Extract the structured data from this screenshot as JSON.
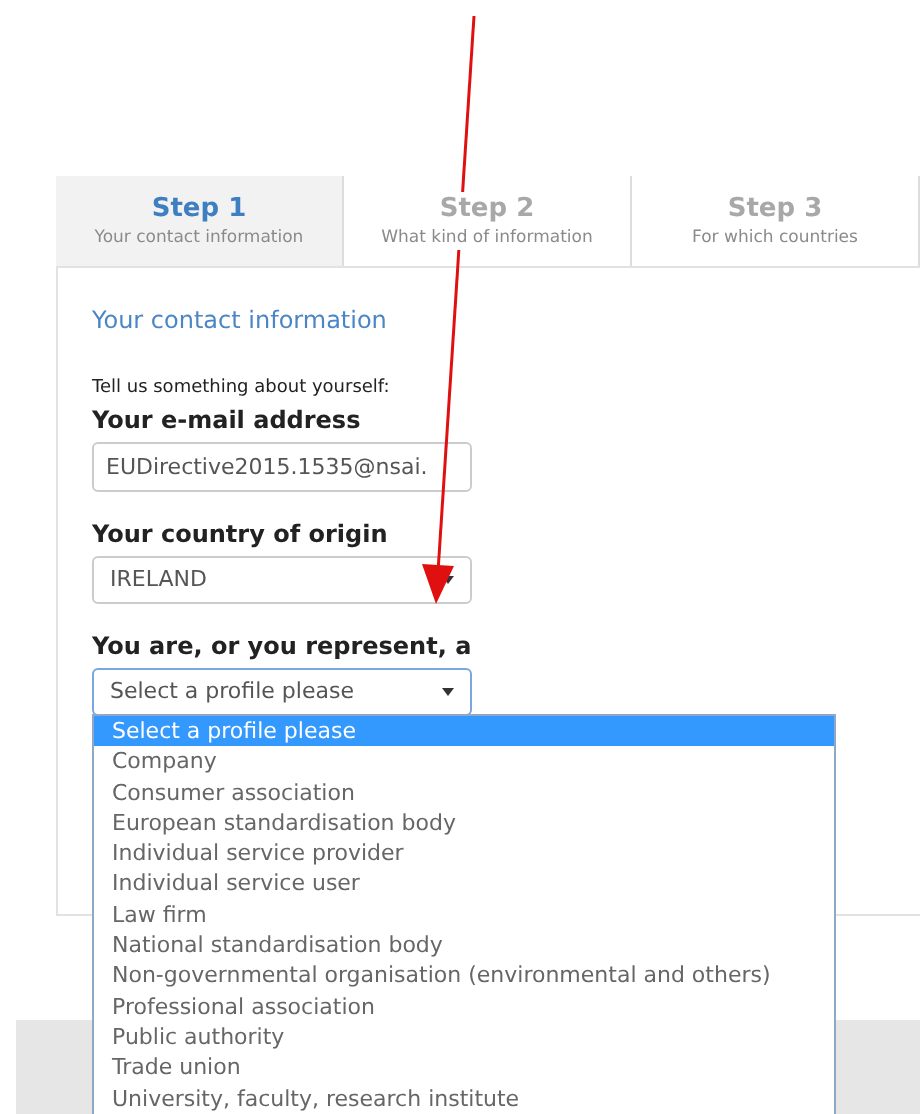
{
  "steps": [
    {
      "title": "Step 1",
      "subtitle": "Your contact information",
      "selected": true
    },
    {
      "title": "Step 2",
      "subtitle": "What kind of information",
      "selected": false
    },
    {
      "title": "Step 3",
      "subtitle": "For which countries",
      "selected": false
    }
  ],
  "section_title": "Your contact information",
  "intro": "Tell us something about yourself:",
  "fields": [
    {
      "label": "Your e-mail address",
      "kind": "text",
      "value": "EUDirective2015.1535@nsai."
    },
    {
      "label": "Your country of origin",
      "kind": "select",
      "value": "IRELAND",
      "open": false
    },
    {
      "label": "You are, or you represent, a",
      "kind": "select",
      "value": "Select a profile please",
      "open": true,
      "options": [
        {
          "label": "Select a profile please",
          "selected": true
        },
        {
          "label": "Company",
          "selected": false
        },
        {
          "label": "Consumer association",
          "selected": false
        },
        {
          "label": "European standardisation body",
          "selected": false
        },
        {
          "label": "Individual service provider",
          "selected": false
        },
        {
          "label": "Individual service user",
          "selected": false
        },
        {
          "label": "Law firm",
          "selected": false
        },
        {
          "label": "National standardisation body",
          "selected": false
        },
        {
          "label": "Non-governmental organisation (environmental and others)",
          "selected": false
        },
        {
          "label": "Professional association",
          "selected": false
        },
        {
          "label": "Public authority",
          "selected": false
        },
        {
          "label": "Trade union",
          "selected": false
        },
        {
          "label": "University, faculty, research institute",
          "selected": false
        }
      ]
    }
  ]
}
